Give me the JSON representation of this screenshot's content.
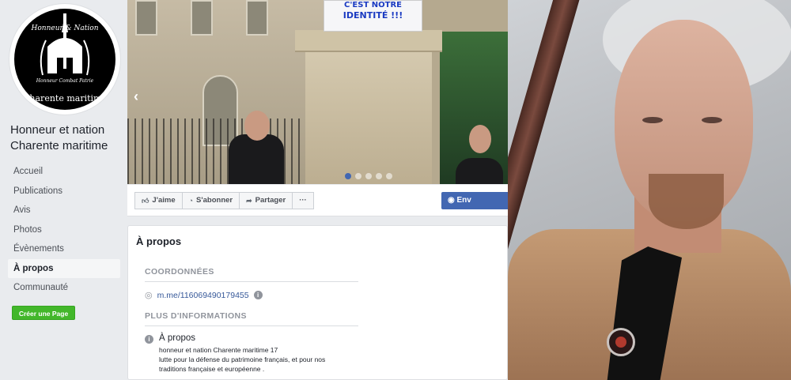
{
  "page": {
    "name": "Honneur et nation Charente maritime"
  },
  "profile_logo": {
    "top_text": "Honneur & Nation",
    "mid_text": "Honneur Combat Patrie",
    "bottom_text": "Charente maritime"
  },
  "sidebar": {
    "items": [
      {
        "label": "Accueil",
        "active": false
      },
      {
        "label": "Publications",
        "active": false
      },
      {
        "label": "Avis",
        "active": false
      },
      {
        "label": "Photos",
        "active": false
      },
      {
        "label": "Évènements",
        "active": false
      },
      {
        "label": "À propos",
        "active": true
      },
      {
        "label": "Communauté",
        "active": false
      }
    ],
    "create_page_label": "Créer une Page"
  },
  "cover": {
    "sign_line1": "C'EST NOTRE",
    "sign_line2": "IDENTITÉ !!!",
    "slide_count": 5,
    "active_slide": 1
  },
  "actions": {
    "like_label": "J'aime",
    "subscribe_label": "S'abonner",
    "share_label": "Partager",
    "more_label": "···",
    "message_label": "Env"
  },
  "about": {
    "title": "À propos",
    "contact_heading": "COORDONNÉES",
    "messenger_link": "m.me/116069490179455",
    "more_heading": "PLUS D'INFORMATIONS",
    "info_title": "À propos",
    "info_line1": "honneur et nation Charente maritime 17",
    "info_line2": "lutte pour la défense du patrimoine français, et pour nos",
    "info_line3": "traditions française et européenne ."
  },
  "colors": {
    "fb_blue": "#4267b2",
    "create_green": "#42b72a",
    "background": "#e9ebee"
  }
}
